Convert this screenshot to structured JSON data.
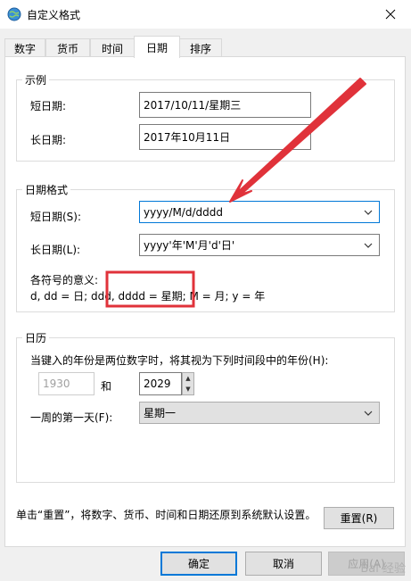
{
  "window": {
    "title": "自定义格式"
  },
  "tabs": [
    {
      "label": "数字"
    },
    {
      "label": "货币"
    },
    {
      "label": "时间"
    },
    {
      "label": "日期"
    },
    {
      "label": "排序"
    }
  ],
  "example": {
    "title": "示例",
    "short_label": "短日期:",
    "short_value": "2017/10/11/星期三",
    "long_label": "长日期:",
    "long_value": "2017年10月11日"
  },
  "date_format": {
    "title": "日期格式",
    "short_label": "短日期(S):",
    "short_value": "yyyy/M/d/dddd",
    "long_label": "长日期(L):",
    "long_value": "yyyy'年'M'月'd'日'",
    "legend_title": "各符号的意义:",
    "legend_text": "d, dd = 日;  ddd, dddd = 星期;  M = 月;  y = 年"
  },
  "calendar": {
    "title": "日历",
    "two_digit_text": "当键入的年份是两位数字时，将其视为下列时间段中的年份(H):",
    "year_from": "1930",
    "and_label": "和",
    "year_to": "2029",
    "first_day_label": "一周的第一天(F):",
    "first_day_value": "星期一"
  },
  "reset": {
    "text": "单击“重置”，将数字、货币、时间和日期还原到系统默认设置。",
    "button": "重置(R)"
  },
  "footer": {
    "ok": "确定",
    "cancel": "取消",
    "apply": "应用(A)"
  },
  "watermark": "Bai 经验",
  "colors": {
    "accent": "#0078d7",
    "annotation": "#e0323a"
  }
}
